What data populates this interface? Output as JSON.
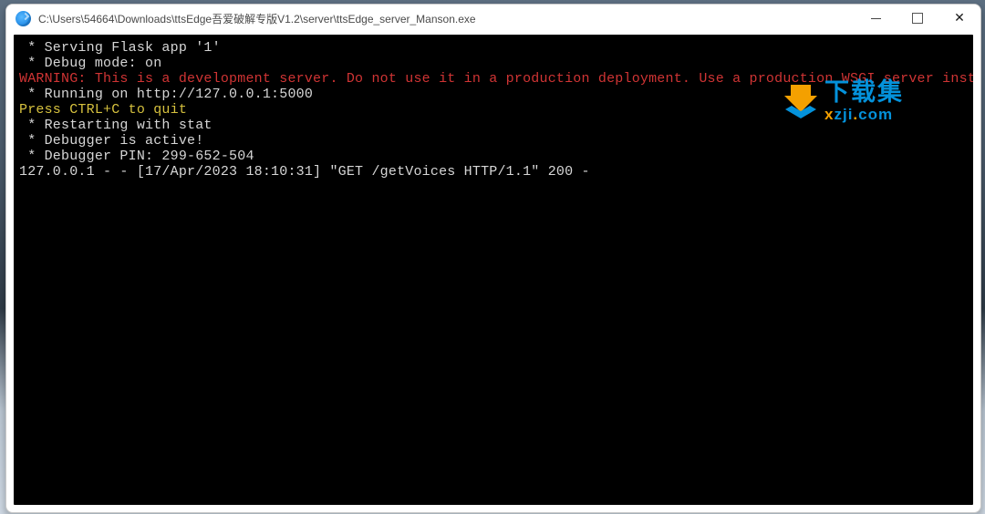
{
  "titlebar": {
    "path": "C:\\Users\\54664\\Downloads\\ttsEdge吾爱破解专版V1.2\\server\\ttsEdge_server_Manson.exe"
  },
  "console": {
    "lines": [
      {
        "class": "ln",
        "text": " * Serving Flask app '1'"
      },
      {
        "class": "ln",
        "text": " * Debug mode: on"
      },
      {
        "class": "red",
        "text": "WARNING: This is a development server. Do not use it in a production deployment. Use a production WSGI server instead."
      },
      {
        "class": "ln",
        "text": " * Running on http://127.0.0.1:5000"
      },
      {
        "class": "yel",
        "text": "Press CTRL+C to quit"
      },
      {
        "class": "ln",
        "text": " * Restarting with stat"
      },
      {
        "class": "ln",
        "text": " * Debugger is active!"
      },
      {
        "class": "ln",
        "text": " * Debugger PIN: 299-652-504"
      },
      {
        "class": "ln",
        "text": "127.0.0.1 - - [17/Apr/2023 18:10:31] \"GET /getVoices HTTP/1.1\" 200 -"
      }
    ]
  },
  "watermark": {
    "big": "下载集",
    "sub_x": "x",
    "sub_mid": "zji",
    "sub_dot": ".",
    "sub_end": "com"
  }
}
